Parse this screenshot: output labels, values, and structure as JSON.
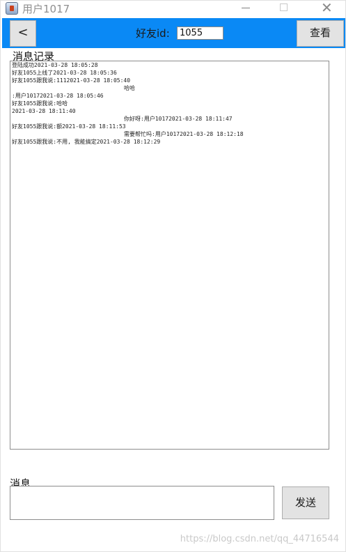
{
  "window": {
    "title": "用户1017"
  },
  "toolbar": {
    "back_label": "<",
    "friend_label": "好友id:",
    "friend_id_value": "1055",
    "view_label": "查看",
    "accent_color": "#0a89f5"
  },
  "history": {
    "label": "消息记录",
    "lines": [
      "登陆成功2021-03-28 18:05:28",
      "好友1055上线了2021-03-28 18:05:36",
      "好友1055跟我说:1112021-03-28 18:05:40",
      "哈哈",
      ":用户10172021-03-28 18:05:46",
      "好友1055跟我说:哈哈",
      "2021-03-28 18:11:40",
      "你好呀:用户10172021-03-28 18:11:47",
      "好友1055跟我说:额2021-03-28 18:11:53",
      "需要帮忙吗:用户10172021-03-28 18:12:18",
      "好友1055跟我说:不用, 我能搞定2021-03-28 18:12:29"
    ]
  },
  "message": {
    "label": "消息",
    "value": "",
    "send_label": "发送"
  },
  "watermark": {
    "text": "https://blog.csdn.net/qq_44716544"
  }
}
